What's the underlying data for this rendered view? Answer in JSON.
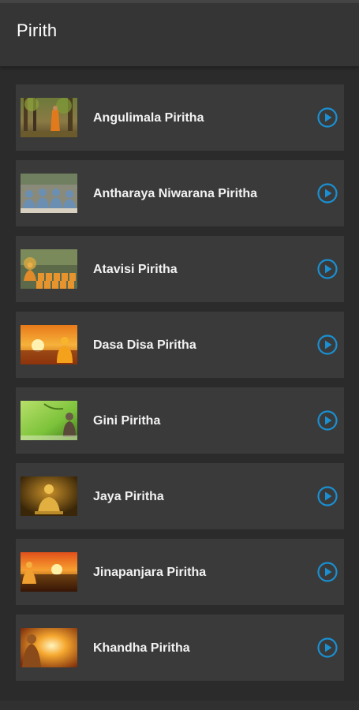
{
  "app": {
    "title": "Pirith"
  },
  "colors": {
    "accent": "#1a8fd1",
    "card_bg": "#3a3a3a",
    "page_bg": "#2b2b2b",
    "appbar_bg": "#353535"
  },
  "items": [
    {
      "label": "Angulimala Piritha",
      "thumb": "forest-monk-thumbnail",
      "icon": "play-circle-icon"
    },
    {
      "label": "Antharaya Niwarana Piritha",
      "thumb": "seated-statues-thumbnail",
      "icon": "play-circle-icon"
    },
    {
      "label": "Atavisi Piritha",
      "thumb": "buddhas-row-thumbnail",
      "icon": "play-circle-icon"
    },
    {
      "label": "Dasa Disa Piritha",
      "thumb": "sunset-buddha-thumbnail",
      "icon": "play-circle-icon"
    },
    {
      "label": "Gini Piritha",
      "thumb": "green-buddha-thumbnail",
      "icon": "play-circle-icon"
    },
    {
      "label": "Jaya Piritha",
      "thumb": "golden-buddha-thumbnail",
      "icon": "play-circle-icon"
    },
    {
      "label": "Jinapanjara Piritha",
      "thumb": "orange-sunset-buddha-thumbnail",
      "icon": "play-circle-icon"
    },
    {
      "label": "Khandha Piritha",
      "thumb": "glowing-buddha-thumbnail",
      "icon": "play-circle-icon"
    }
  ]
}
